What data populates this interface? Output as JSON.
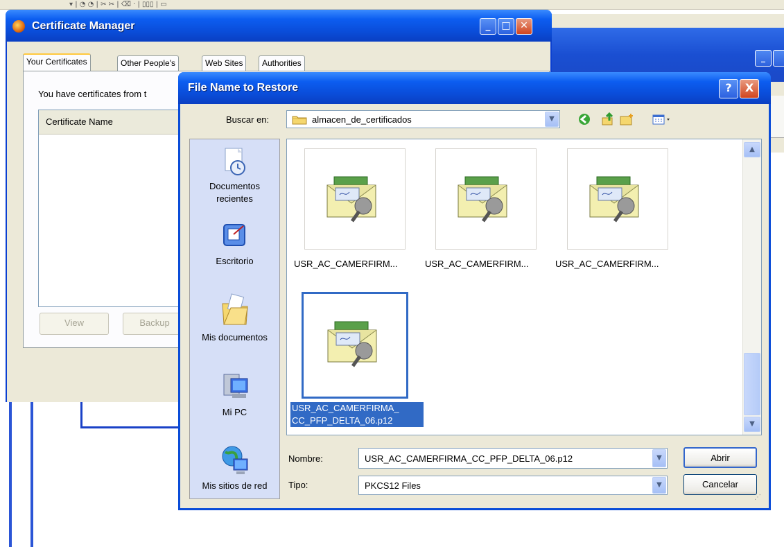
{
  "cert_manager": {
    "title": "Certificate Manager",
    "tabs": [
      "Your Certificates",
      "Other People's",
      "Web Sites",
      "Authorities"
    ],
    "description": "You have certificates from t",
    "column_header": "Certificate Name",
    "buttons": {
      "view": "View",
      "backup": "Backup"
    }
  },
  "dialog": {
    "title": "File Name to Restore",
    "look_in_label": "Buscar en:",
    "look_in_value": "almacen_de_certificados",
    "places": [
      {
        "icon": "recent-documents-icon",
        "label_lines": [
          "Documentos",
          "recientes"
        ]
      },
      {
        "icon": "desktop-icon",
        "label_lines": [
          "Escritorio"
        ]
      },
      {
        "icon": "my-documents-icon",
        "label_lines": [
          "Mis documentos"
        ]
      },
      {
        "icon": "my-computer-icon",
        "label_lines": [
          "Mi PC"
        ]
      },
      {
        "icon": "network-places-icon",
        "label_lines": [
          "Mis sitios de red"
        ]
      }
    ],
    "files": [
      {
        "label": "USR_AC_CAMERFIRM...",
        "selected": false
      },
      {
        "label": "USR_AC_CAMERFIRM...",
        "selected": false
      },
      {
        "label": "USR_AC_CAMERFIRM...",
        "selected": false
      },
      {
        "label": "USR_AC_CAMERFIRMA_ CC_PFP_DELTA_06.p12",
        "selected": true
      }
    ],
    "filename_label": "Nombre:",
    "filename_value": "USR_AC_CAMERFIRMA_CC_PFP_DELTA_06.p12",
    "filetype_label": "Tipo:",
    "filetype_value": "PKCS12 Files",
    "open_button": "Abrir",
    "cancel_button": "Cancelar",
    "help_button": "?",
    "close_button": "X"
  },
  "colors": {
    "titlebar": "#0a4cd8",
    "selection": "#316ac5",
    "places_bg": "#d6dff7",
    "window_bg": "#ece9d8"
  }
}
